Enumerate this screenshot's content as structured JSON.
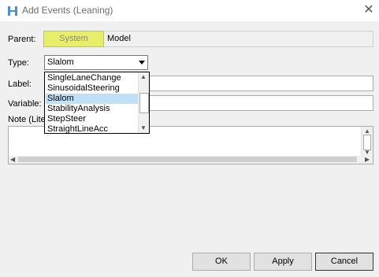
{
  "window": {
    "title": "Add Events (Leaning)"
  },
  "form": {
    "parent_label": "Parent:",
    "parent_button": "System",
    "parent_value": "Model",
    "type_label": "Type:",
    "type_value": "Slalom",
    "label_label": "Label:",
    "label_value": "",
    "variable_label": "Variable:",
    "variable_value": "",
    "note_label": "Note (Liter",
    "note_value": ""
  },
  "dropdown": {
    "options": [
      "SingleLaneChange",
      "SinusoidalSteering",
      "Slalom",
      "StabilityAnalysis",
      "StepSteer",
      "StraightLineAcc"
    ],
    "selected_index": 2
  },
  "buttons": {
    "ok": "OK",
    "apply": "Apply",
    "cancel": "Cancel"
  },
  "colors": {
    "system_button": "#e6ee6a",
    "selected_option": "#bfe0f5"
  }
}
